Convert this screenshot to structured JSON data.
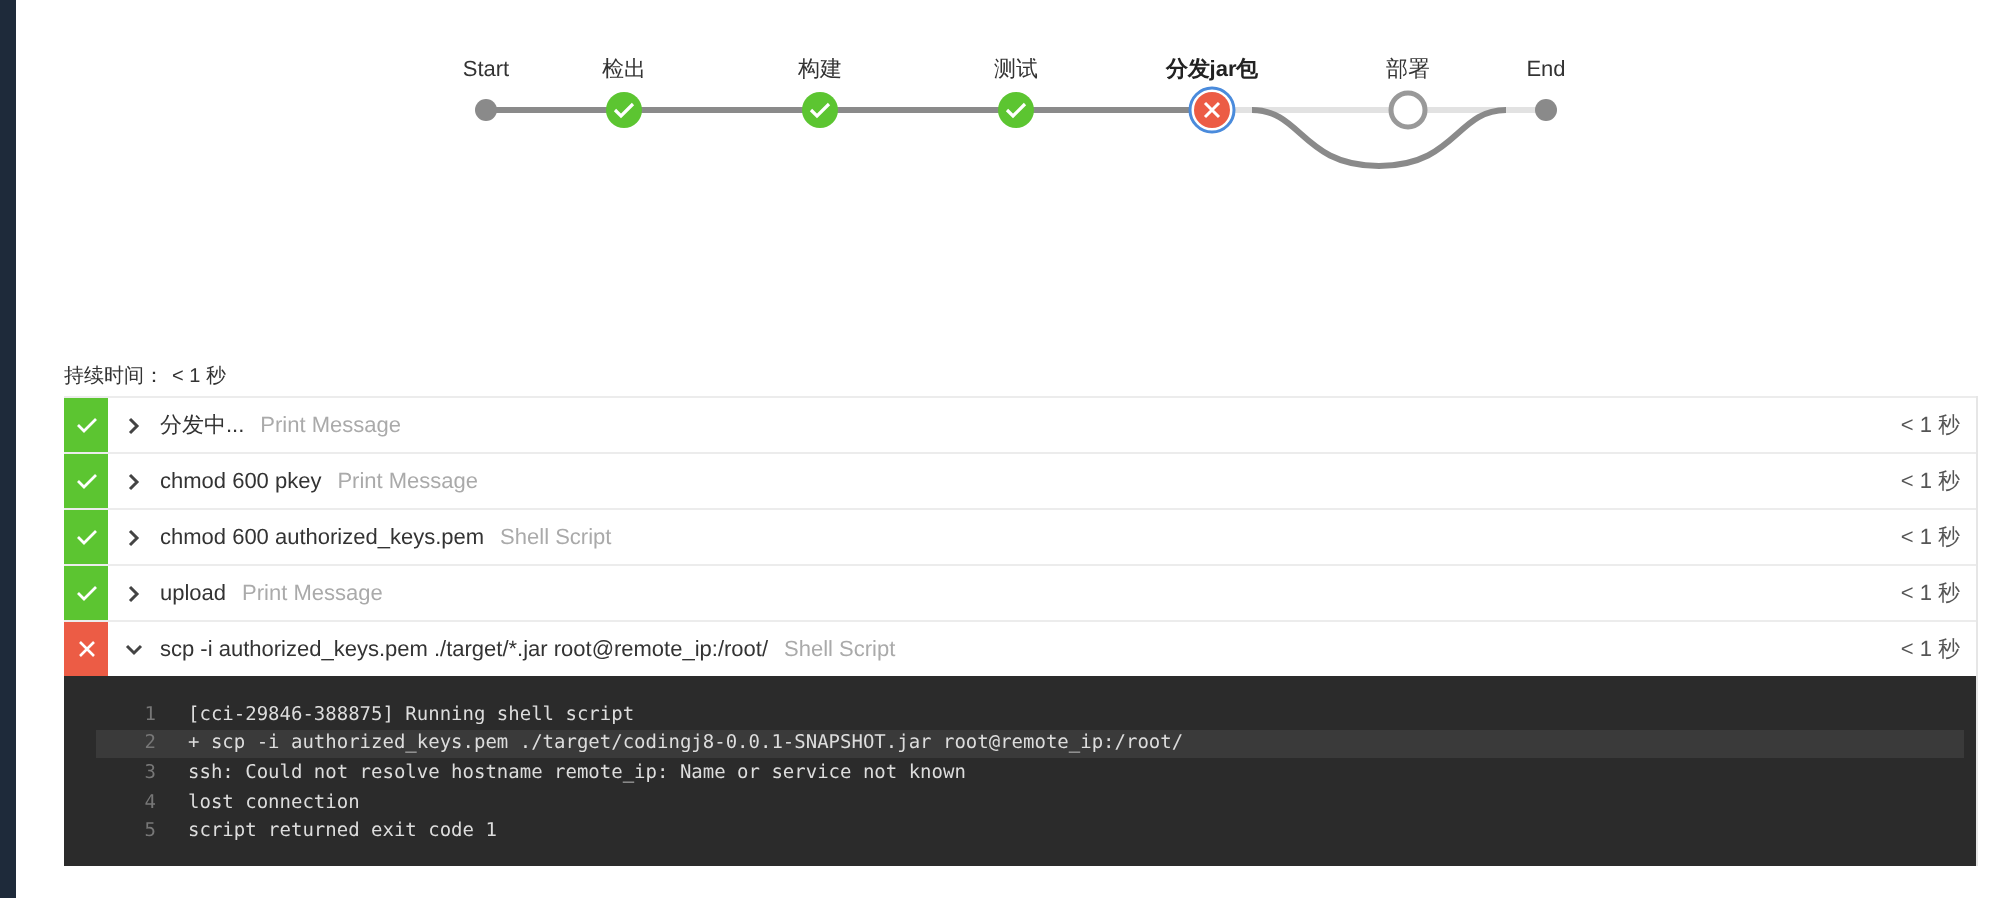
{
  "pipeline": {
    "stages": [
      {
        "label": "Start",
        "kind": "start",
        "selected": false
      },
      {
        "label": "检出",
        "kind": "success",
        "selected": false
      },
      {
        "label": "构建",
        "kind": "success",
        "selected": false
      },
      {
        "label": "测试",
        "kind": "success",
        "selected": false
      },
      {
        "label": "分发jar包",
        "kind": "failed",
        "selected": true
      },
      {
        "label": "部署",
        "kind": "skipped",
        "selected": false
      },
      {
        "label": "End",
        "kind": "end",
        "selected": false
      }
    ]
  },
  "duration": {
    "label": "持续时间：",
    "value": "< 1 秒"
  },
  "steps": [
    {
      "name": "分发中...",
      "type": "Print Message",
      "time": "< 1 秒",
      "failed": false,
      "expanded": false
    },
    {
      "name": "chmod 600 pkey",
      "type": "Print Message",
      "time": "< 1 秒",
      "failed": false,
      "expanded": false
    },
    {
      "name": "chmod 600 authorized_keys.pem",
      "type": "Shell Script",
      "time": "< 1 秒",
      "failed": false,
      "expanded": false
    },
    {
      "name": "upload",
      "type": "Print Message",
      "time": "< 1 秒",
      "failed": false,
      "expanded": false
    },
    {
      "name": "scp -i authorized_keys.pem ./target/*.jar root@remote_ip:/root/",
      "type": "Shell Script",
      "time": "< 1 秒",
      "failed": true,
      "expanded": true
    }
  ],
  "log": [
    {
      "number": "1",
      "text": "[cci-29846-388875] Running shell script",
      "highlighted": false
    },
    {
      "number": "2",
      "text": "+ scp -i authorized_keys.pem ./target/codingj8-0.0.1-SNAPSHOT.jar root@remote_ip:/root/",
      "highlighted": true
    },
    {
      "number": "3",
      "text": "ssh: Could not resolve hostname remote_ip: Name or service not known",
      "highlighted": false
    },
    {
      "number": "4",
      "text": "lost connection",
      "highlighted": false
    },
    {
      "number": "5",
      "text": "script returned exit code 1",
      "highlighted": false
    }
  ]
}
